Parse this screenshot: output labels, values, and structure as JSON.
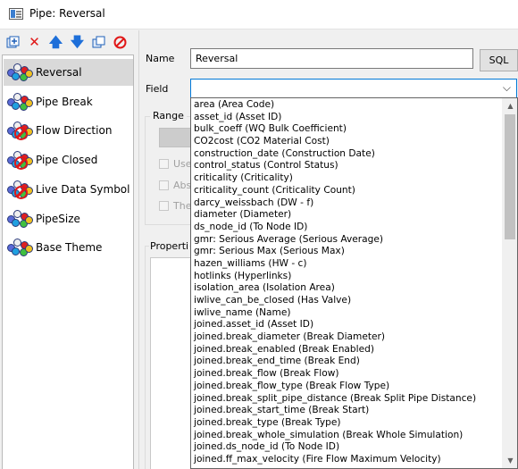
{
  "window": {
    "title": "Pipe: Reversal"
  },
  "toolbar": {
    "buttons": [
      {
        "name": "add-theme-icon"
      },
      {
        "name": "delete-icon"
      },
      {
        "name": "move-up-icon"
      },
      {
        "name": "move-down-icon"
      },
      {
        "name": "copy-icon"
      },
      {
        "name": "disable-icon"
      }
    ]
  },
  "themes": [
    {
      "label": "Reversal",
      "icon": "theme-dots-icon",
      "selected": true
    },
    {
      "label": "Pipe Break",
      "icon": "theme-dots-icon"
    },
    {
      "label": "Flow Direction",
      "icon": "theme-disabled-icon"
    },
    {
      "label": "Pipe Closed",
      "icon": "theme-disabled-icon"
    },
    {
      "label": "Live Data Symbol",
      "icon": "theme-disabled-icon"
    },
    {
      "label": "PipeSize",
      "icon": "theme-dots-icon"
    },
    {
      "label": "Base Theme",
      "icon": "theme-dots-icon"
    }
  ],
  "form": {
    "name_label": "Name",
    "name_value": "Reversal",
    "sql_button": "SQL",
    "field_label": "Field",
    "field_value": "",
    "range_label": "Range",
    "checkbox1_label": "Use",
    "checkbox2_label": "Abs",
    "checkbox3_label": "The",
    "properties_label": "Properti"
  },
  "field_options": [
    "area (Area Code)",
    "asset_id (Asset ID)",
    "bulk_coeff (WQ Bulk Coefficient)",
    "CO2cost (CO2 Material Cost)",
    "construction_date (Construction Date)",
    "control_status (Control Status)",
    "criticality (Criticality)",
    "criticality_count (Criticality Count)",
    "darcy_weissbach (DW - f)",
    "diameter (Diameter)",
    "ds_node_id (To Node ID)",
    "gmr: Serious Average (Serious Average)",
    "gmr: Serious Max (Serious Max)",
    "hazen_williams (HW - c)",
    "hotlinks (Hyperlinks)",
    "isolation_area (Isolation Area)",
    "iwlive_can_be_closed (Has Valve)",
    "iwlive_name (Name)",
    "joined.asset_id (Asset ID)",
    "joined.break_diameter (Break Diameter)",
    "joined.break_enabled (Break Enabled)",
    "joined.break_end_time (Break End)",
    "joined.break_flow (Break Flow)",
    "joined.break_flow_type (Break Flow Type)",
    "joined.break_split_pipe_distance (Break Split Pipe Distance)",
    "joined.break_start_time (Break Start)",
    "joined.break_type (Break Type)",
    "joined.break_whole_simulation (Break Whole Simulation)",
    "joined.ds_node_id (To Node ID)",
    "joined.ff_max_velocity (Fire Flow Maximum Velocity)"
  ],
  "colors": {
    "accent": "#0078d7",
    "delete": "#e01818",
    "arrow": "#1e6fd9"
  }
}
